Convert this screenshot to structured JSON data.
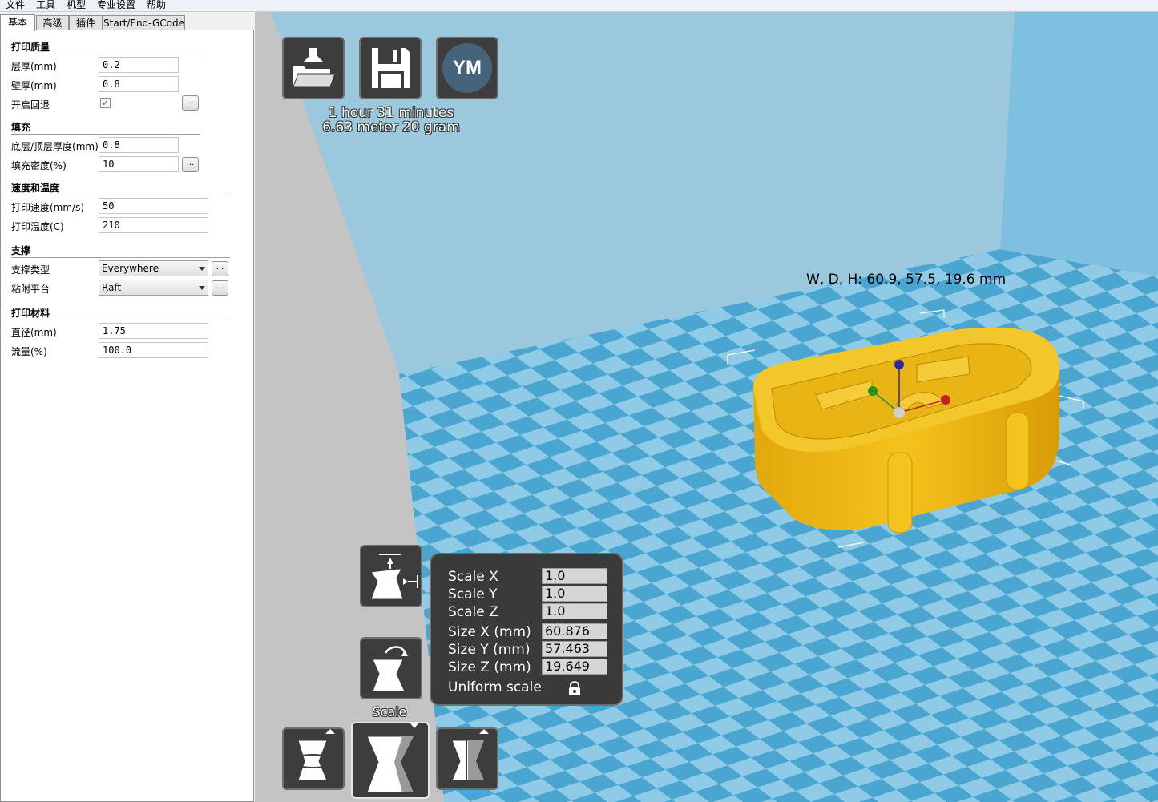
{
  "menu": [
    "文件",
    "工具",
    "机型",
    "专业设置",
    "帮助"
  ],
  "tabs": [
    "基本",
    "高级",
    "插件",
    "Start/End-GCode"
  ],
  "sections": {
    "quality": {
      "title": "打印质量",
      "layer_height": {
        "label": "层厚(mm)",
        "value": "0.2"
      },
      "shell_thickness": {
        "label": "壁厚(mm)",
        "value": "0.8"
      },
      "retraction": {
        "label": "开启回退",
        "checked": true
      }
    },
    "fill": {
      "title": "填充",
      "bottom_top": {
        "label": "底层/顶层厚度(mm)",
        "value": "0.8"
      },
      "density": {
        "label": "填充密度(%)",
        "value": "10"
      }
    },
    "speed": {
      "title": "速度和温度",
      "print_speed": {
        "label": "打印速度(mm/s)",
        "value": "50"
      },
      "print_temp": {
        "label": "打印温度(C)",
        "value": "210"
      }
    },
    "support": {
      "title": "支撑",
      "support_type": {
        "label": "支撑类型",
        "value": "Everywhere"
      },
      "adhesion": {
        "label": "粘附平台",
        "value": "Raft"
      }
    },
    "material": {
      "title": "打印材料",
      "diameter": {
        "label": "直径(mm)",
        "value": "1.75"
      },
      "flow": {
        "label": "流量(%)",
        "value": "100.0"
      }
    }
  },
  "dots_label": "...",
  "check_mark": "✓",
  "toolbar": {
    "ym_label": "YM"
  },
  "print_info": {
    "time": "1 hour 31 minutes",
    "material": "6.63 meter 20 gram"
  },
  "dimensions_label": "W, D, H: 60.9, 57.5, 19.6 mm",
  "scale_panel": {
    "title": "Scale",
    "scale_x": {
      "label": "Scale X",
      "value": "1.0"
    },
    "scale_y": {
      "label": "Scale Y",
      "value": "1.0"
    },
    "scale_z": {
      "label": "Scale Z",
      "value": "1.0"
    },
    "size_x": {
      "label": "Size X (mm)",
      "value": "60.876"
    },
    "size_y": {
      "label": "Size Y (mm)",
      "value": "57.463"
    },
    "size_z": {
      "label": "Size Z (mm)",
      "value": "19.649"
    },
    "uniform": {
      "label": "Uniform scale"
    }
  },
  "colors": {
    "model": "#f5c21b",
    "floor_light": "#8fcbe6",
    "floor_dark": "#4aa6d0",
    "wall": "#93c4da",
    "panel": "#3a3a3a"
  }
}
